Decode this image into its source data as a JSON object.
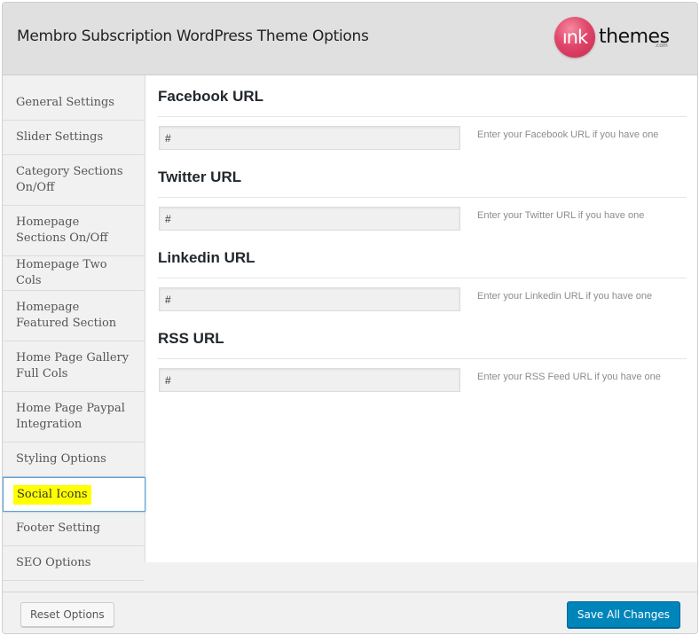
{
  "header": {
    "title": "Membro Subscription WordPress Theme Options",
    "logo": {
      "circle_text": "ınk",
      "text": "themes",
      "suffix": ".com",
      "brand_color": "#e0476a"
    }
  },
  "sidebar": {
    "items": [
      {
        "label": "General Settings",
        "active": false
      },
      {
        "label": "Slider Settings",
        "active": false
      },
      {
        "label": "Category Sections On/Off",
        "active": false
      },
      {
        "label": "Homepage Sections On/Off",
        "active": false
      },
      {
        "label": "Homepage Two Cols",
        "active": false
      },
      {
        "label": "Homepage Featured Section",
        "active": false
      },
      {
        "label": "Home Page Gallery Full Cols",
        "active": false
      },
      {
        "label": "Home Page Paypal Integration",
        "active": false
      },
      {
        "label": "Styling Options",
        "active": false
      },
      {
        "label": "Social Icons",
        "active": true
      },
      {
        "label": "Footer Setting",
        "active": false
      },
      {
        "label": "SEO Options",
        "active": false
      }
    ],
    "active_highlight_color": "#ffff00"
  },
  "content": {
    "sections": [
      {
        "title": "Facebook URL",
        "value": "#",
        "description": "Enter your Facebook URL if you have one"
      },
      {
        "title": "Twitter URL",
        "value": "#",
        "description": "Enter your Twitter URL if you have one"
      },
      {
        "title": "Linkedin URL",
        "value": "#",
        "description": "Enter your Linkedin URL if you have one"
      },
      {
        "title": "RSS URL",
        "value": "#",
        "description": "Enter your RSS Feed URL if you have one"
      }
    ]
  },
  "footer": {
    "reset_label": "Reset Options",
    "save_label": "Save All Changes",
    "save_color": "#0085ba"
  }
}
